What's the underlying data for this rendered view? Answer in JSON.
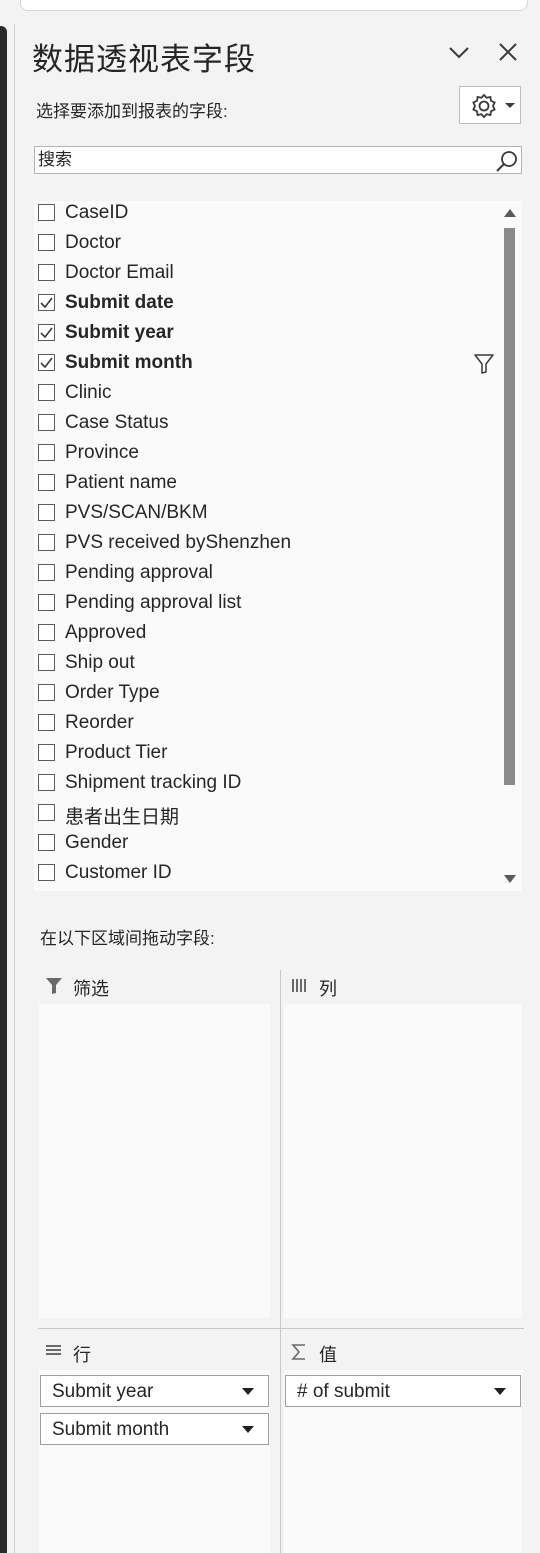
{
  "pane": {
    "title": "数据透视表字段",
    "subtitle": "选择要添加到报表的字段:",
    "search_placeholder": "搜索",
    "collapse_icon": "chevron-down-icon",
    "close_icon": "close-icon",
    "settings_icon": "gear-icon"
  },
  "fields": [
    {
      "label": "CaseID",
      "checked": false
    },
    {
      "label": "Doctor",
      "checked": false
    },
    {
      "label": "Doctor Email",
      "checked": false
    },
    {
      "label": "Submit date",
      "checked": true
    },
    {
      "label": "Submit year",
      "checked": true
    },
    {
      "label": "Submit month",
      "checked": true,
      "filtered": true
    },
    {
      "label": "Clinic",
      "checked": false
    },
    {
      "label": "Case Status",
      "checked": false
    },
    {
      "label": "Province",
      "checked": false
    },
    {
      "label": "Patient name",
      "checked": false
    },
    {
      "label": "PVS/SCAN/BKM",
      "checked": false
    },
    {
      "label": "PVS received byShenzhen",
      "checked": false
    },
    {
      "label": "Pending approval",
      "checked": false
    },
    {
      "label": "Pending approval list",
      "checked": false
    },
    {
      "label": "Approved",
      "checked": false
    },
    {
      "label": "Ship out",
      "checked": false
    },
    {
      "label": "Order Type",
      "checked": false
    },
    {
      "label": "Reorder",
      "checked": false
    },
    {
      "label": "Product Tier",
      "checked": false
    },
    {
      "label": "Shipment tracking ID",
      "checked": false
    },
    {
      "label": "患者出生日期",
      "checked": false
    },
    {
      "label": "Gender",
      "checked": false
    },
    {
      "label": "Customer ID",
      "checked": false
    }
  ],
  "areas": {
    "drag_hint": "在以下区域间拖动字段:",
    "filters": {
      "label": "筛选",
      "icon": "filter-icon",
      "items": []
    },
    "columns": {
      "label": "列",
      "icon": "columns-icon",
      "items": []
    },
    "rows": {
      "label": "行",
      "icon": "rows-icon",
      "items": [
        "Submit year",
        "Submit month"
      ]
    },
    "values": {
      "label": "值",
      "icon": "sigma-icon",
      "items": [
        "# of submit"
      ]
    }
  },
  "colors": {
    "pane_background": "#f3f3f3",
    "list_background": "#fafafa",
    "scroll_thumb": "#8a8a8a"
  }
}
